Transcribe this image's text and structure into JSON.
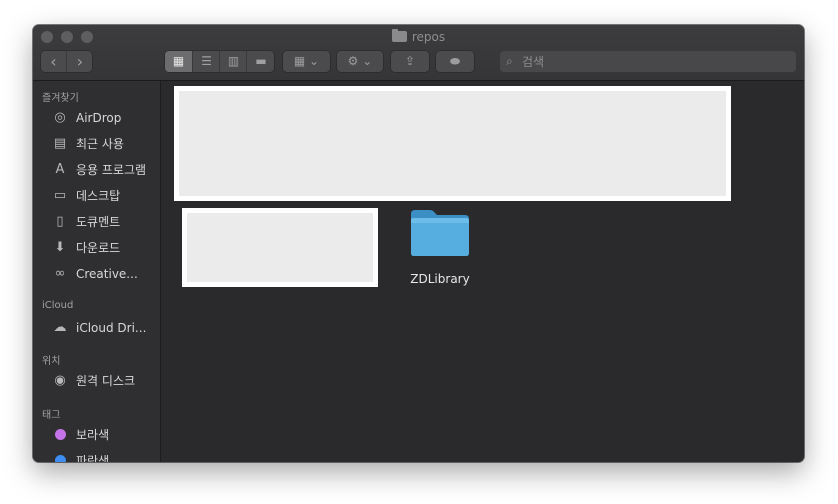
{
  "window": {
    "title": "repos",
    "title_icon": "folder-icon",
    "traffic_lights": [
      "close",
      "minimize",
      "zoom"
    ]
  },
  "toolbar": {
    "back_glyph": "‹",
    "forward_glyph": "›",
    "view_modes": [
      {
        "name": "icon-view",
        "icon": "grid-icon",
        "glyph": "▦",
        "selected": true
      },
      {
        "name": "list-view",
        "icon": "list-icon",
        "glyph": "☰",
        "selected": false
      },
      {
        "name": "column-view",
        "icon": "columns-icon",
        "glyph": "▥",
        "selected": false
      },
      {
        "name": "gallery-view",
        "icon": "gallery-icon",
        "glyph": "▬",
        "selected": false
      }
    ],
    "group_glyph": "▦ ⌄",
    "action_glyph": "⚙ ⌄",
    "share_glyph": "⇪",
    "tag_glyph": "⬬"
  },
  "search": {
    "placeholder": "검색",
    "value": ""
  },
  "sidebar": {
    "favorites_header": "즐겨찾기",
    "favorites": [
      {
        "label": "AirDrop",
        "icon": "airdrop-icon",
        "glyph": "◎"
      },
      {
        "label": "최근 사용",
        "icon": "recents-icon",
        "glyph": "▤"
      },
      {
        "label": "응용 프로그램",
        "icon": "applications-icon",
        "glyph": "A"
      },
      {
        "label": "데스크탑",
        "icon": "desktop-icon",
        "glyph": "▭"
      },
      {
        "label": "도큐멘트",
        "icon": "documents-icon",
        "glyph": "▯"
      },
      {
        "label": "다운로드",
        "icon": "downloads-icon",
        "glyph": "⬇"
      },
      {
        "label": "Creative...",
        "icon": "creative-cloud-icon",
        "glyph": "∞"
      }
    ],
    "icloud_header": "iCloud",
    "icloud": [
      {
        "label": "iCloud Dri...",
        "icon": "cloud-icon",
        "glyph": "☁"
      }
    ],
    "locations_header": "위치",
    "locations": [
      {
        "label": "원격 디스크",
        "icon": "remote-disc-icon",
        "glyph": "◉"
      }
    ],
    "tags_header": "태그",
    "tags": [
      {
        "label": "보라색",
        "color": "#c474e8"
      },
      {
        "label": "파란색",
        "color": "#3d8ef0"
      }
    ]
  },
  "content": {
    "folders": [
      {
        "label": "ZDLibrary",
        "icon": "folder-icon",
        "color": "#4aa3d8"
      }
    ],
    "redacted_colors": {
      "fill": "#ebebeb",
      "border": "#ffffff"
    }
  }
}
